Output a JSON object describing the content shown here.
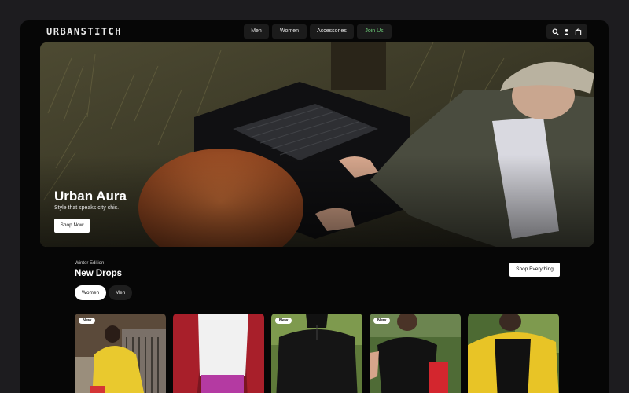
{
  "brand": {
    "logo": "URBANSTITCH"
  },
  "nav": {
    "items": [
      {
        "label": "Men"
      },
      {
        "label": "Women"
      },
      {
        "label": "Accessories"
      },
      {
        "label": "Join Us"
      }
    ]
  },
  "header_icons": [
    "search-icon",
    "user-icon",
    "bag-icon"
  ],
  "hero": {
    "title": "Urban Aura",
    "subtitle": "Style that speaks city chic.",
    "cta": "Shop Now"
  },
  "section": {
    "eyebrow": "Winter Edition",
    "title": "New Drops",
    "cta": "Shop Everything",
    "filters": [
      {
        "label": "Women",
        "active": true
      },
      {
        "label": "Men",
        "active": false
      }
    ]
  },
  "products": [
    {
      "badge": "New"
    },
    {
      "badge": ""
    },
    {
      "badge": "New"
    },
    {
      "badge": "New"
    },
    {
      "badge": ""
    }
  ],
  "colors": {
    "background": "#060606",
    "accent_join": "#6fd07b",
    "button": "#ffffff"
  }
}
